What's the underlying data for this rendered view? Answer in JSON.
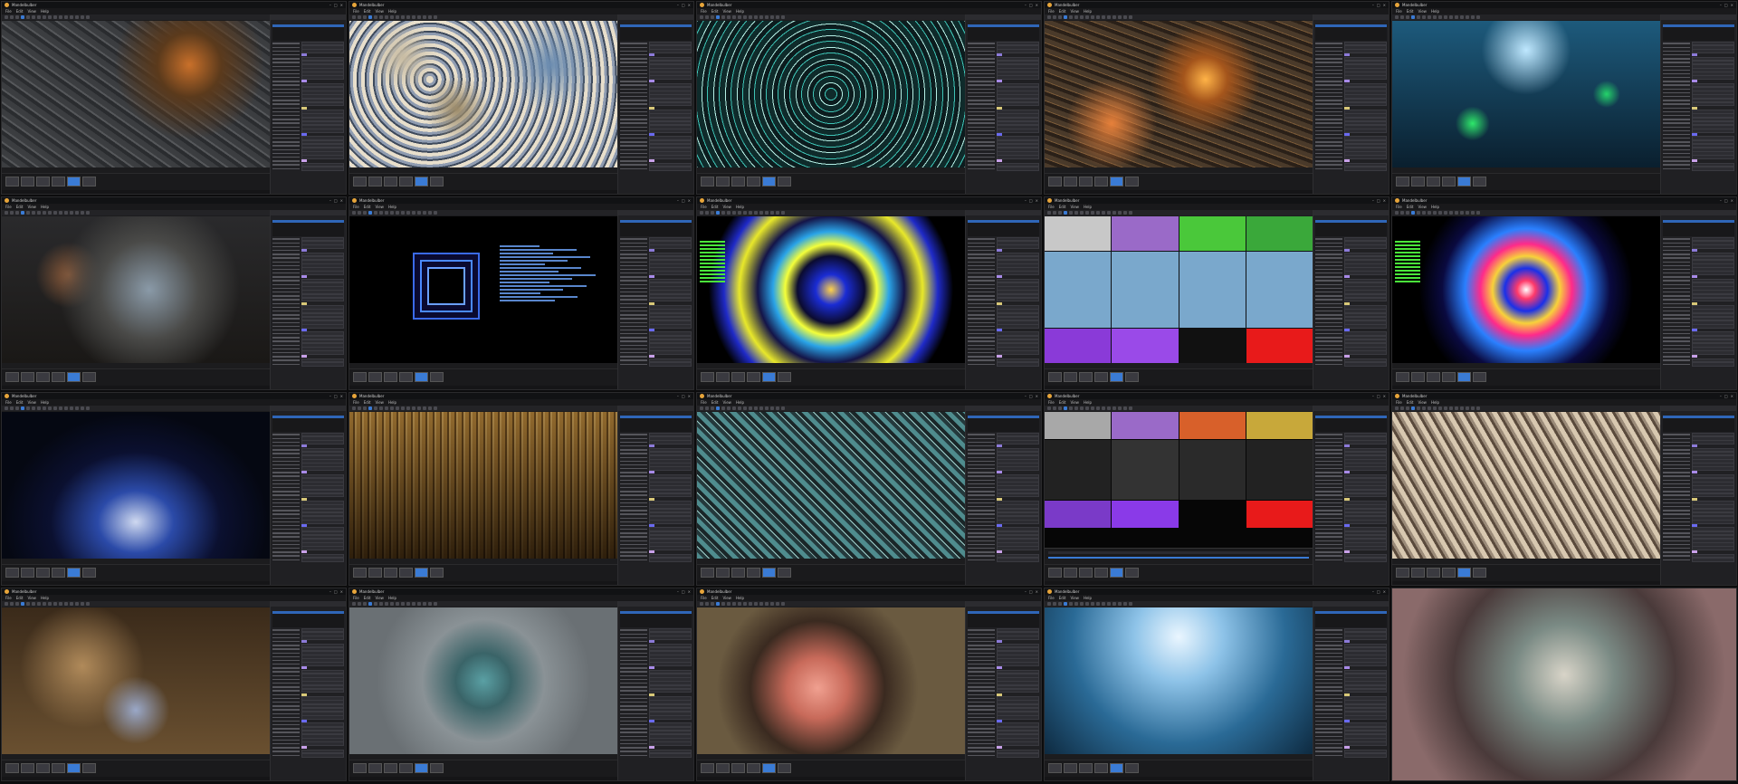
{
  "app": {
    "name": "Mandelbulber",
    "menu": [
      "File",
      "Edit",
      "View",
      "Help"
    ]
  },
  "tiles": [
    {
      "art": "art1",
      "style": "ui"
    },
    {
      "art": "art2",
      "style": "ui"
    },
    {
      "art": "art3",
      "style": "ui"
    },
    {
      "art": "art4",
      "style": "ui"
    },
    {
      "art": "art5",
      "style": "ui"
    },
    {
      "art": "art6",
      "style": "ui"
    },
    {
      "art": "art7",
      "style": "terminal"
    },
    {
      "art": "art8",
      "style": "ui"
    },
    {
      "art": "art9",
      "style": "passes"
    },
    {
      "art": "art10",
      "style": "ui"
    },
    {
      "art": "art11",
      "style": "ui"
    },
    {
      "art": "art12",
      "style": "ui"
    },
    {
      "art": "art13",
      "style": "ui"
    },
    {
      "art": "art14",
      "style": "timeline"
    },
    {
      "art": "art15",
      "style": "ui"
    },
    {
      "art": "art16",
      "style": "ui"
    },
    {
      "art": "art17",
      "style": "ui"
    },
    {
      "art": "art18",
      "style": "ui"
    },
    {
      "art": "art19",
      "style": "ui"
    },
    {
      "art": "art20",
      "style": "full"
    }
  ],
  "colors": {
    "accent": "#3a7bd5",
    "project_tag": "#e8c23a",
    "window_bg": "#1c1c1e"
  }
}
